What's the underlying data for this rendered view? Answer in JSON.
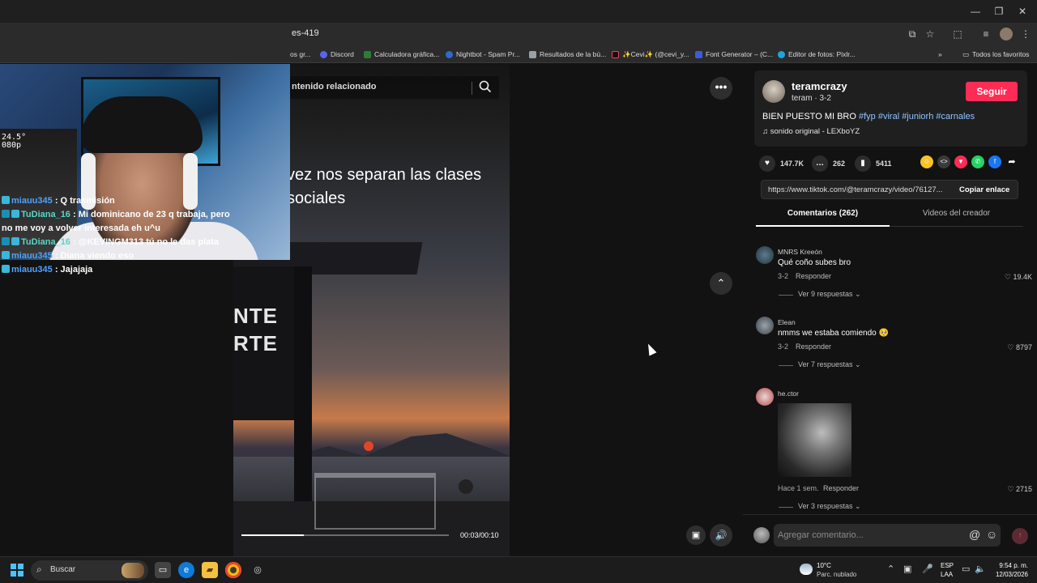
{
  "browser": {
    "url_fragment": "es-419",
    "bookmarks": [
      {
        "label": "os gr...",
        "icon": "bookmark-icon",
        "color": "#888888"
      },
      {
        "label": "Discord",
        "icon": "discord-icon",
        "color": "#5865f2"
      },
      {
        "label": "Calculadora gráfica...",
        "icon": "desmos-icon",
        "color": "#2f7d32"
      },
      {
        "label": "Nightbot - Spam Pr...",
        "icon": "nightbot-icon",
        "color": "#2b6bcc"
      },
      {
        "label": "Resultados de la bú...",
        "icon": "doc-icon",
        "color": "#9aa0a6"
      },
      {
        "label": "✨Cevi✨ (@cevi_y...",
        "icon": "tiktok-icon",
        "color": "#111111"
      },
      {
        "label": "Font Generator – (C...",
        "icon": "font-icon",
        "color": "#3b5bdb"
      },
      {
        "label": "Editor de fotos: Pixlr...",
        "icon": "pixlr-icon",
        "color": "#1fa4e0"
      }
    ],
    "all_favorites": "Todos los favoritos"
  },
  "webcam": {
    "hud_line1": "24.5°",
    "hud_line2": "080p"
  },
  "chat": [
    {
      "user": "miauu345",
      "user_style": "a",
      "text": ": Q trasmisión"
    },
    {
      "user": "TuDiana_16",
      "user_style": "b",
      "text": ": Mi dominicano de 23 q trabaja, pero no me voy a volver interesada eh u^u"
    },
    {
      "user": "TuDiana_16",
      "user_style": "b",
      "text": ": @KEVINGM313 tú no le das plata"
    },
    {
      "user": "miauu345",
      "user_style": "a",
      "text": ": Diana viendo eso"
    },
    {
      "user": "miauu345",
      "user_style": "a",
      "text": ": Jajajaja"
    }
  ],
  "video": {
    "related_label": "ntenido relacionado",
    "caption": "vez nos separan las clases sociales",
    "sign_line1": "NTE",
    "sign_line2": "RTE",
    "time": "00:03/00:10",
    "progress": 0.3
  },
  "post": {
    "author": "teramcrazy",
    "author_sub": "teram · 3-2",
    "follow_label": "Seguir",
    "desc_text": "BIEN PUESTO MI BRO ",
    "hashtags": "#fyp #viral #juniorh #carnales",
    "music": "sonido original - LEXboYZ",
    "likes": "147.7K",
    "comments": "262",
    "saves": "5411",
    "link": "https://www.tiktok.com/@teramcrazy/video/76127...",
    "copy_label": "Copiar enlace",
    "tab_comments": "Comentarios (262)",
    "tab_videos": "Videos del creador",
    "share_colors": [
      "#f7c325",
      "#3a3a3a",
      "#fe2c55",
      "#25d366",
      "#1877f2",
      "#121212"
    ]
  },
  "comments": [
    {
      "user": "MNRS Kreeón",
      "text": "Qué coño subes bro",
      "date": "3-2",
      "reply": "Responder",
      "likes": "19.4K",
      "more": "Ver 9 respuestas"
    },
    {
      "user": "Elean",
      "text": "nmms we estaba comiendo 🥺",
      "date": "3-2",
      "reply": "Responder",
      "likes": "8797",
      "more": "Ver 7 respuestas"
    },
    {
      "user": "he.ctor",
      "text": "",
      "date": "Hace 1 sem.",
      "reply": "Responder",
      "likes": "2715",
      "more": "Ver 3 respuestas"
    }
  ],
  "comment_bar": {
    "placeholder": "Agregar comentario..."
  },
  "taskbar": {
    "search": "Buscar",
    "weather_temp": "10°C",
    "weather_desc": "Parc. nublado",
    "lang1": "ESP",
    "lang2": "LAA",
    "time": "9:54 p. m.",
    "date": "12/03/2026"
  }
}
